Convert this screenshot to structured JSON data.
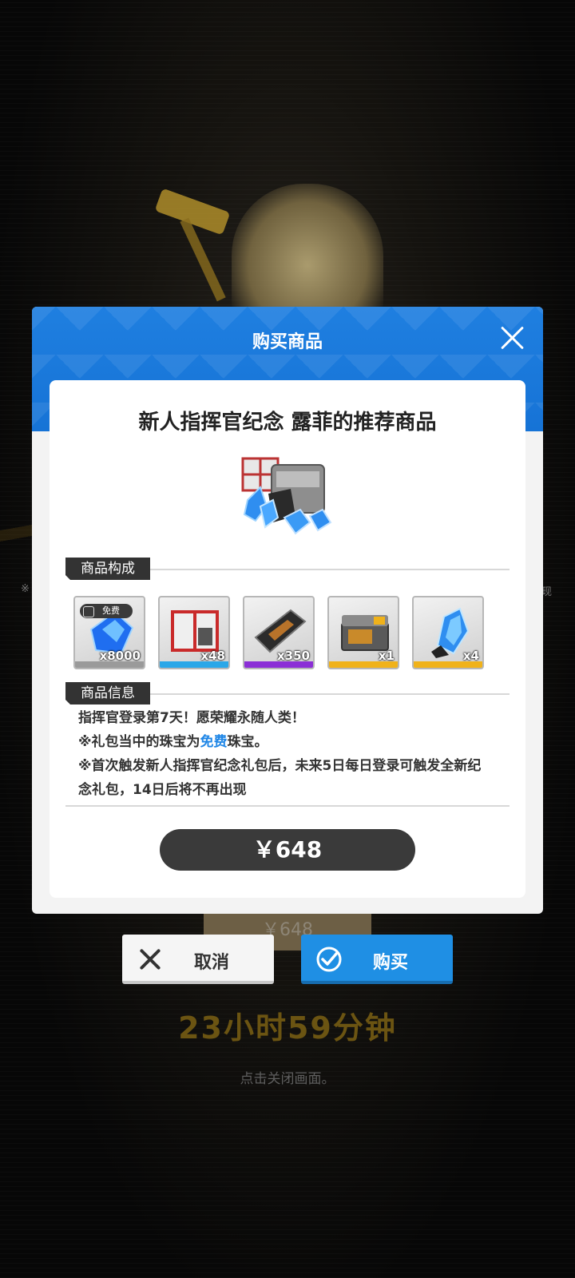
{
  "background": {
    "left_note": "※",
    "right_note": "现",
    "price": "￥648",
    "timer": "23小时59分钟",
    "hint": "点击关闭画面。"
  },
  "modal": {
    "title": "购买商品",
    "close_icon": "close-icon",
    "card_title": "新人指挥官纪念 露菲的推荐商品",
    "contents_label": "商品构成",
    "info_label": "商品信息",
    "items": [
      {
        "icon": "gem-icon",
        "qty": "x8000",
        "tag": "免费",
        "accent": "#9a9a9a"
      },
      {
        "icon": "supply-box-icon",
        "qty": "x48",
        "accent": "#2aa7e8"
      },
      {
        "icon": "chip-module-icon",
        "qty": "x350",
        "accent": "#8b2fd6"
      },
      {
        "icon": "treasure-chest-icon",
        "qty": "x1",
        "accent": "#f0b21a"
      },
      {
        "icon": "crystal-icon",
        "qty": "x4",
        "accent": "#f0b21a"
      }
    ],
    "info_lines": {
      "l1": "指挥官登录第7天！愿荣耀永随人类！",
      "l2_pre": "※礼包当中的珠宝为",
      "l2_hl": "免费",
      "l2_post": "珠宝。",
      "l3": "※首次触发新人指挥官纪念礼包后，未来5日每日登录可触发全新纪念礼包，14日后将不再出现"
    },
    "price": "￥648"
  },
  "buttons": {
    "cancel": "取消",
    "buy": "购买"
  },
  "colors": {
    "header_blue": "#1673d6",
    "highlight_blue": "#1f86e6",
    "buy_blue": "#1f8fe4"
  }
}
